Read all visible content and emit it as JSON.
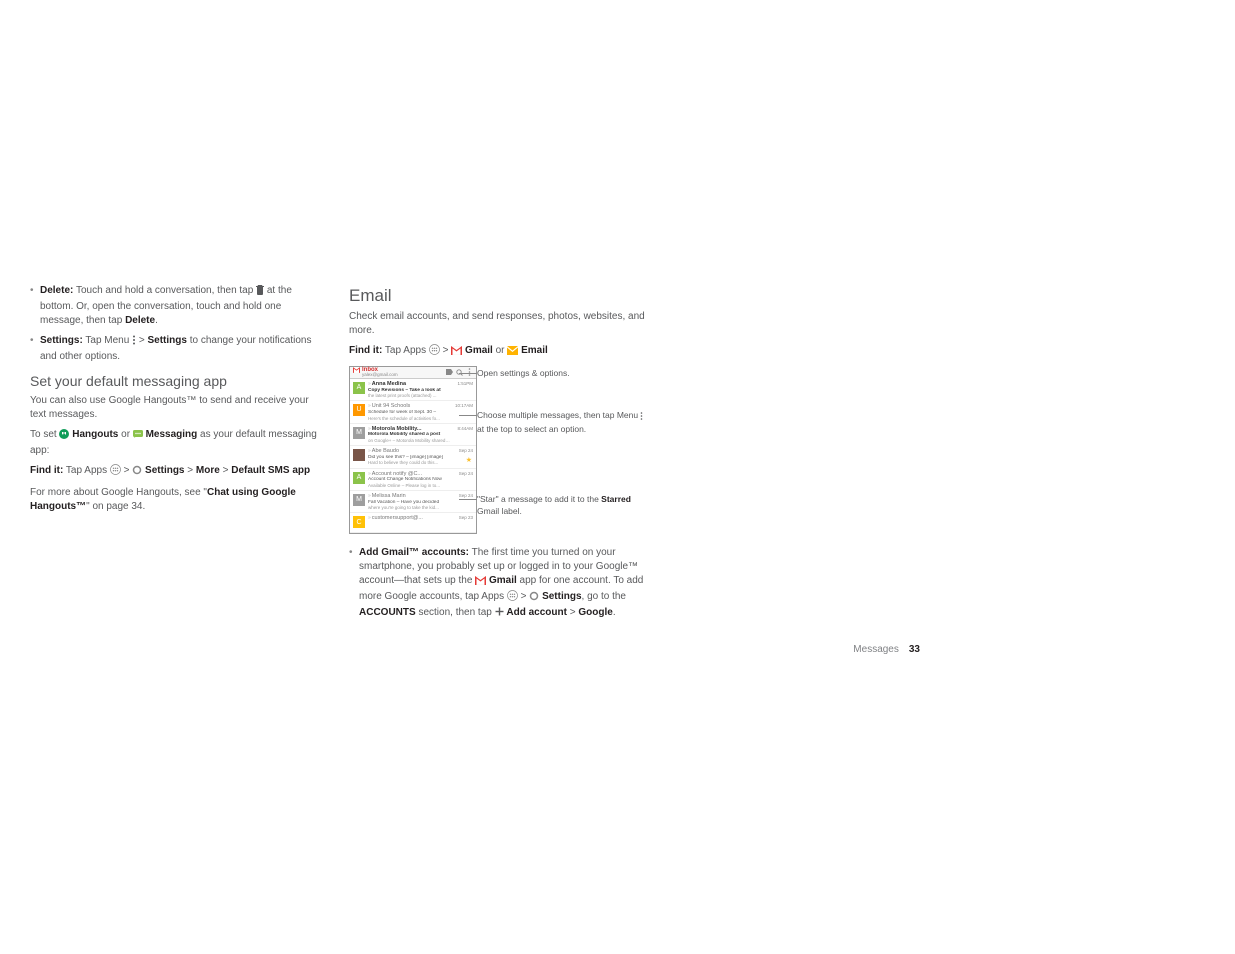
{
  "left": {
    "delete_label": "Delete:",
    "delete_text1": " Touch and hold a conversation, then tap ",
    "delete_text2": " at the bottom. Or, open the conversation, touch and hold one message, then tap ",
    "delete_action": "Delete",
    "settings_label": "Settings:",
    "settings_text1": " Tap Menu ",
    "settings_arrow": " > ",
    "settings_bold": "Settings",
    "settings_text2": " to change your notifications and other options.",
    "h2": "Set your default messaging app",
    "p1": "You can also use Google Hangouts™ to send and receive your text messages.",
    "p2a": "To set ",
    "hangouts": "Hangouts",
    "p2b": " or ",
    "messaging": "Messaging",
    "p2c": " as your default messaging app:",
    "findit": "Find it:",
    "findit_a": " Tap Apps ",
    "findit_b": "Settings",
    "findit_c": "More",
    "findit_d": "Default SMS app",
    "p3a": "For more about Google Hangouts, see \"",
    "p3b": "Chat using Google Hangouts™",
    "p3c": "\" on page 34."
  },
  "right": {
    "h1": "Email",
    "intro": "Check email accounts, and send responses, photos, websites, and more.",
    "findit": "Find it:",
    "findit_a": " Tap Apps ",
    "gmail": "Gmail",
    "or": " or ",
    "email": "Email",
    "callout1": "Open settings & options.",
    "callout2a": "Choose multiple messages, then tap Menu ",
    "callout2b": " at the top to select an option.",
    "callout3a": "\"Star\" a message to add it to the ",
    "callout3b": "Starred",
    "callout3c": " Gmail label.",
    "add_label": "Add Gmail™ accounts:",
    "add_t1": " The first time you turned on your smartphone, you probably set up or logged in to your Google™ account—that sets up the ",
    "add_gmail": "Gmail",
    "add_t2": " app for one account. To add more Google accounts, tap Apps ",
    "add_t3": "Settings",
    "add_t4": ", go to the ",
    "add_accounts": "ACCOUNTS",
    "add_t5": " section, then tap ",
    "add_addacct": "Add account",
    "add_google": "Google"
  },
  "phone": {
    "title": "Inbox",
    "sub": "yalex@gmail.com",
    "rows": [
      {
        "avatar": "A",
        "color": "#8bc34a",
        "sender": "Anna Medina",
        "bold": true,
        "subj": "Copy Revisions – Take a look at",
        "prev": "the latest print proofs (attached) ...",
        "time": "1:51PM"
      },
      {
        "avatar": "U",
        "color": "#ff9800",
        "sender": "Unit 94 Schools",
        "bold": false,
        "subj": "Schedule for week of Sept. 30 –",
        "prev": "Here's the schedule of activities fo...",
        "time": "10:17AM"
      },
      {
        "avatar": "M",
        "color": "#9e9e9e",
        "sender": "Motorola Mobility...",
        "bold": true,
        "subj": "Motorola Mobility shared a post",
        "prev": "on Google+ – Motorola Mobility shared a ...",
        "time": "8:44AM"
      },
      {
        "avatar": "",
        "color": "#795548",
        "sender": "Abe Baudo",
        "bold": false,
        "subj": "Did you see this? – [image] [image]",
        "prev": "Hard to believe they could do this...",
        "time": "Sep 24",
        "star": true
      },
      {
        "avatar": "A",
        "color": "#8bc34a",
        "sender": "Account notify @C...",
        "bold": false,
        "subj": "Account Change Notifications Now",
        "prev": "Available Online – Please log in to...",
        "time": "Sep 24"
      },
      {
        "avatar": "M",
        "color": "#9e9e9e",
        "sender": "Melissa Marin",
        "bold": false,
        "subj": "Fall Vacation – Have you decided",
        "prev": "where you're going to take the kid...",
        "time": "Sep 24"
      },
      {
        "avatar": "C",
        "color": "#ffc107",
        "sender": "customersupport@...",
        "bold": false,
        "subj": "",
        "prev": "",
        "time": "Sep 23"
      }
    ]
  },
  "footer": {
    "section": "Messages",
    "page": "33"
  }
}
